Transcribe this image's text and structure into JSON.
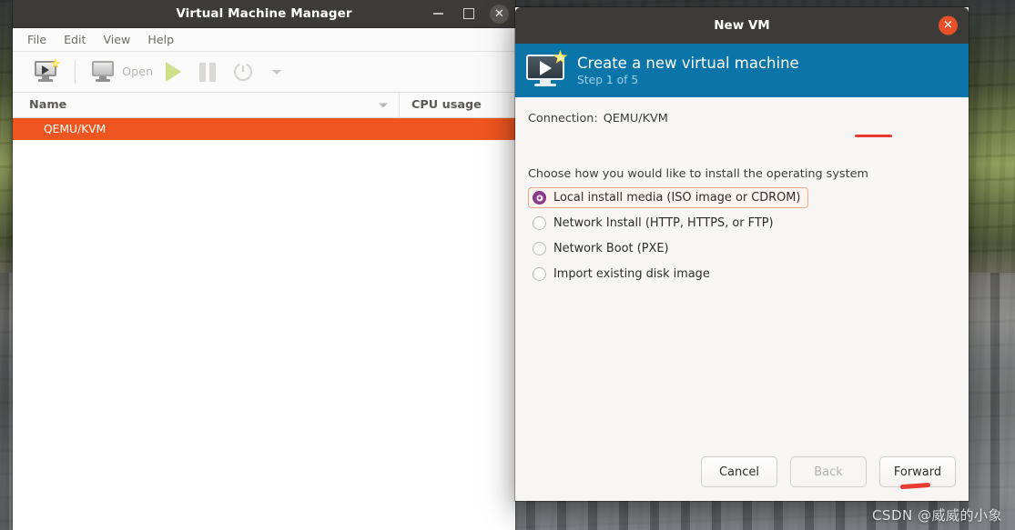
{
  "desktop": {
    "watermark": "CSDN @威威的小象"
  },
  "vmm_window": {
    "title": "Virtual Machine Manager",
    "window_buttons": {
      "minimize": "–",
      "maximize": "□",
      "close": "✕"
    },
    "menubar": [
      "File",
      "Edit",
      "View",
      "Help"
    ],
    "toolbar": {
      "new_vm_icon": "new-vm-monitor-icon",
      "open_label": "Open",
      "open_icon": "monitor-icon",
      "run_icon": "play-icon",
      "pause_icon": "pause-icon",
      "shutdown_icon": "power-icon",
      "shutdown_menu_icon": "chevron-down-icon"
    },
    "list": {
      "columns": [
        "Name",
        "CPU usage"
      ],
      "rows": [
        {
          "name": "QEMU/KVM",
          "cpu_usage": "",
          "selected": true
        }
      ]
    }
  },
  "new_vm_dialog": {
    "title": "New VM",
    "close_glyph": "✕",
    "banner": {
      "heading": "Create a new virtual machine",
      "subheading": "Step 1 of 5",
      "icon": "new-vm-monitor-icon"
    },
    "connection": {
      "label": "Connection:",
      "value": "QEMU/KVM"
    },
    "prompt": "Choose how you would like to install the operating system",
    "install_options": [
      {
        "label": "Local install media (ISO image or CDROM)",
        "selected": true,
        "focused": true
      },
      {
        "label": "Network Install (HTTP, HTTPS, or FTP)",
        "selected": false,
        "focused": false
      },
      {
        "label": "Network Boot (PXE)",
        "selected": false,
        "focused": false
      },
      {
        "label": "Import existing disk image",
        "selected": false,
        "focused": false
      }
    ],
    "buttons": {
      "cancel": "Cancel",
      "back": "Back",
      "forward": "Forward"
    }
  },
  "colors": {
    "titlebar": "#3c3b37",
    "banner_blue": "#0b74a8",
    "selection_orange": "#ef5520",
    "close_orange": "#e8502a",
    "radio_purple": "#8c3d8c",
    "annotation_red": "#ea3a32",
    "focus_outline": "#eaa98c"
  }
}
